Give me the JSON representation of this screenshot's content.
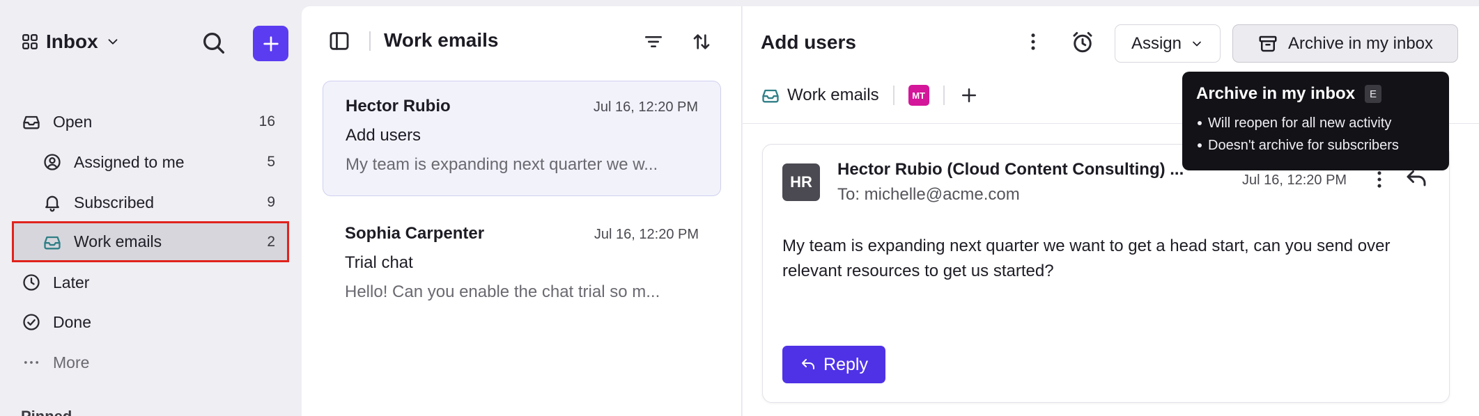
{
  "sidebar": {
    "inbox_title": "Inbox",
    "items": [
      {
        "label": "Open",
        "count": "16",
        "icon": "inbox-tray-icon"
      },
      {
        "label": "Assigned to me",
        "count": "5",
        "icon": "user-circle-icon"
      },
      {
        "label": "Subscribed",
        "count": "9",
        "icon": "bell-icon"
      },
      {
        "label": "Work emails",
        "count": "2",
        "icon": "inbox-tray-icon"
      },
      {
        "label": "Later",
        "count": "",
        "icon": "clock-icon"
      },
      {
        "label": "Done",
        "count": "",
        "icon": "check-circle-icon"
      },
      {
        "label": "More",
        "count": "",
        "icon": "more-dots-icon"
      }
    ],
    "section_title_cut": "Pinned"
  },
  "list": {
    "title": "Work emails",
    "conversations": [
      {
        "sender": "Hector Rubio",
        "date": "Jul 16, 12:20 PM",
        "subject": "Add users",
        "preview": "My team is expanding next quarter we w..."
      },
      {
        "sender": "Sophia Carpenter",
        "date": "Jul 16, 12:20 PM",
        "subject": "Trial chat",
        "preview": "Hello! Can you enable the chat trial so m..."
      }
    ]
  },
  "detail": {
    "title": "Add users",
    "assign_label": "Assign",
    "archive_label": "Archive in my inbox",
    "inbox_tag": "Work emails",
    "assignee_initials": "MT",
    "tooltip": {
      "title": "Archive in my inbox",
      "shortcut": "E",
      "bullets": [
        "Will reopen for all new activity",
        "Doesn't archive for subscribers"
      ]
    },
    "message": {
      "avatar_initials": "HR",
      "from": "Hector Rubio (Cloud Content Consulting) ...",
      "to": "To: michelle@acme.com",
      "date": "Jul 16, 12:20 PM",
      "body": "My team is expanding next quarter we want to get a head start, can you send over relevant resources to get us started?",
      "reply_label": "Reply"
    }
  },
  "colors": {
    "accent": "#5b3cf0",
    "reply_button": "#4f32e6",
    "assignee_badge": "#d4169a",
    "inbox_tag_icon": "#2f7f86",
    "highlight_outline": "#e0231c",
    "tooltip_bg": "#131217"
  }
}
